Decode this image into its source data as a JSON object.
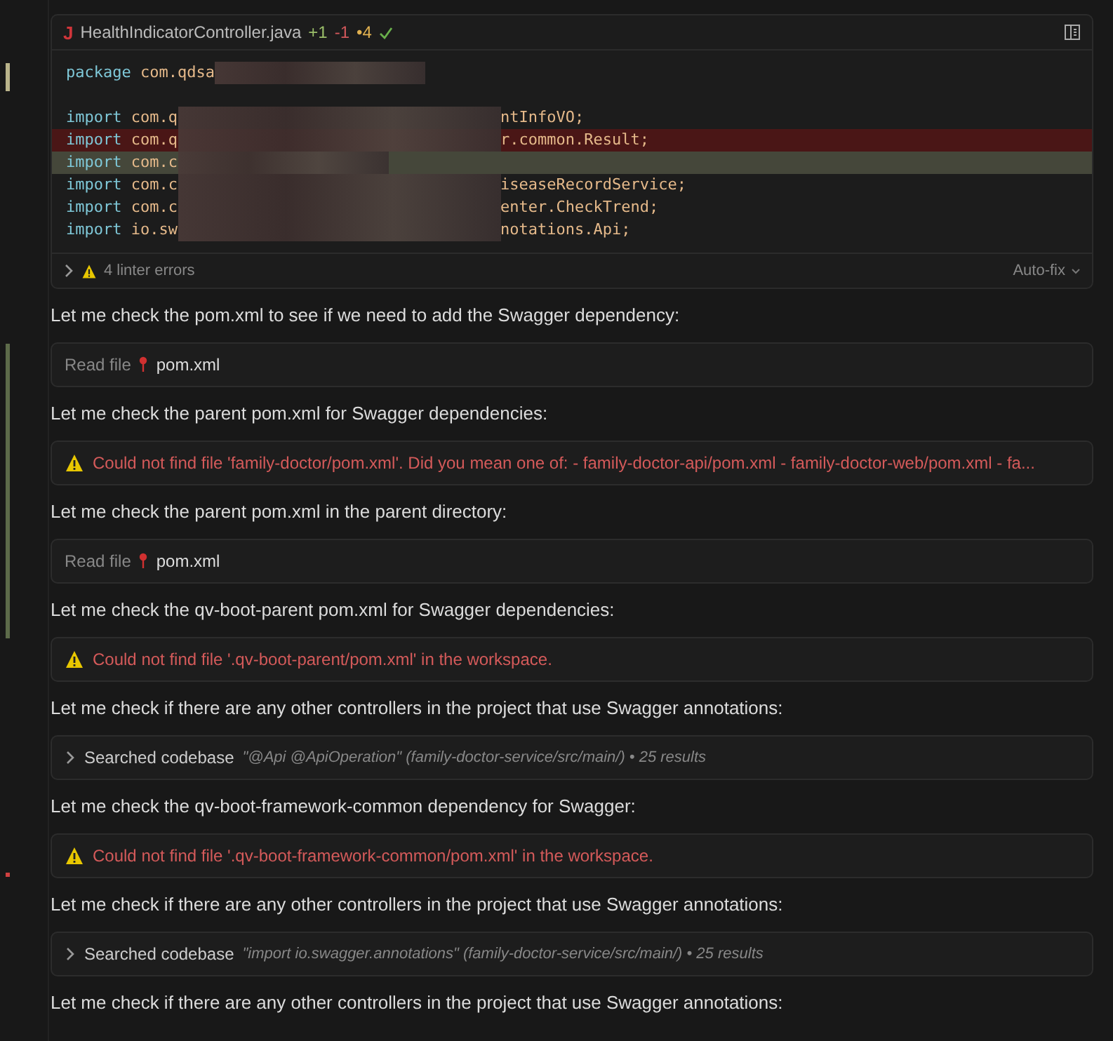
{
  "code_card": {
    "file_icon": "J",
    "filename": "HealthIndicatorController.java",
    "added": "+1",
    "removed": "-1",
    "errors_badge": "•4",
    "lines": [
      {
        "kind": "code",
        "head": "package com.qdsa",
        "added": false,
        "removed": false
      },
      {
        "kind": "blank"
      },
      {
        "kind": "code",
        "head": "import com.q",
        "tail": "ntInfoVO;",
        "added": false,
        "removed": false
      },
      {
        "kind": "code",
        "head": "import com.q",
        "tail": "r.common.Result;",
        "added": false,
        "removed": true
      },
      {
        "kind": "code",
        "head": "import com.c",
        "added": true,
        "removed": false
      },
      {
        "kind": "code",
        "head": "import com.c",
        "tail": "iseaseRecordService;",
        "added": false,
        "removed": false
      },
      {
        "kind": "code",
        "head": "import com.c",
        "tail": "enter.CheckTrend;",
        "added": false,
        "removed": false
      },
      {
        "kind": "code",
        "head": "import io.sw",
        "tail": "notations.Api;",
        "added": false,
        "removed": false
      }
    ],
    "linter": "4 linter errors",
    "autofix": "Auto-fix"
  },
  "messages": [
    {
      "kind": "text",
      "text": "Let me check the pom.xml to see if we need to add the Swagger dependency:"
    },
    {
      "kind": "read_file",
      "label": "Read file",
      "file": "pom.xml"
    },
    {
      "kind": "text",
      "text": "Let me check the parent pom.xml for Swagger dependencies:"
    },
    {
      "kind": "error",
      "text": "Could not find file 'family-doctor/pom.xml'. Did you mean one of: - family-doctor-api/pom.xml - family-doctor-web/pom.xml - fa..."
    },
    {
      "kind": "text",
      "text": "Let me check the parent pom.xml in the parent directory:"
    },
    {
      "kind": "read_file",
      "label": "Read file",
      "file": "pom.xml"
    },
    {
      "kind": "text",
      "text": "Let me check the qv-boot-parent pom.xml for Swagger dependencies:"
    },
    {
      "kind": "error",
      "text": "Could not find file '.qv-boot-parent/pom.xml' in the workspace."
    },
    {
      "kind": "text",
      "text": "Let me check if there are any other controllers in the project that use Swagger annotations:"
    },
    {
      "kind": "search",
      "label": "Searched codebase",
      "query": "\"@Api @ApiOperation\" (family-doctor-service/src/main/) • 25 results"
    },
    {
      "kind": "text",
      "text": "Let me check the qv-boot-framework-common dependency for Swagger:"
    },
    {
      "kind": "error",
      "text": "Could not find file '.qv-boot-framework-common/pom.xml' in the workspace."
    },
    {
      "kind": "text",
      "text": "Let me check if there are any other controllers in the project that use Swagger annotations:"
    },
    {
      "kind": "search",
      "label": "Searched codebase",
      "query": "\"import io.swagger.annotations\" (family-doctor-service/src/main/) • 25 results"
    },
    {
      "kind": "text",
      "text": "Let me check if there are any other controllers in the project that use Swagger annotations:"
    }
  ]
}
